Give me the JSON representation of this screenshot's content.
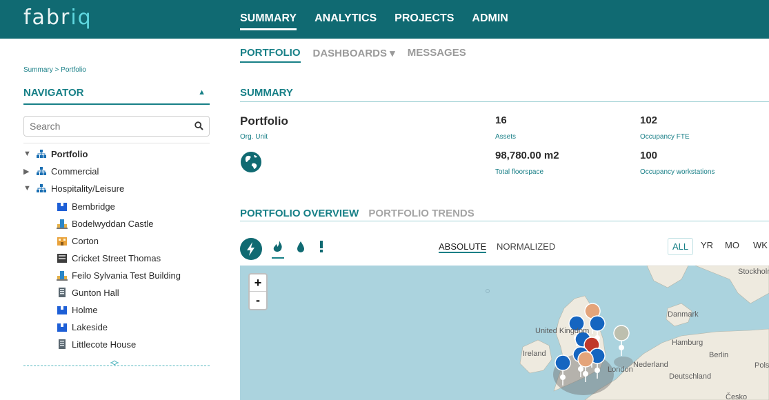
{
  "header": {
    "logo": "fabriq",
    "logo_main": "fabr",
    "logo_accent": "iq",
    "nav": [
      "SUMMARY",
      "ANALYTICS",
      "PROJECTS",
      "ADMIN"
    ],
    "active_nav": "SUMMARY"
  },
  "subnav": {
    "portfolio": "PORTFOLIO",
    "dashboards": "DASHBOARDS ▾",
    "messages": "MESSAGES"
  },
  "breadcrumb": "Summary > Portfolio",
  "navigator": {
    "title": "NAVIGATOR",
    "search_placeholder": "Search",
    "tree": [
      {
        "label": "Portfolio",
        "type": "org",
        "expanded": true
      },
      {
        "label": "Commercial",
        "type": "org",
        "expanded": false
      },
      {
        "label": "Hospitality/Leisure",
        "type": "org",
        "expanded": true
      },
      {
        "label": "Bembridge",
        "type": "building-blue"
      },
      {
        "label": "Bodelwyddan Castle",
        "type": "building-site"
      },
      {
        "label": "Corton",
        "type": "building-orange"
      },
      {
        "label": "Cricket Street Thomas",
        "type": "building-dark"
      },
      {
        "label": "Feilo Sylvania Test Building",
        "type": "building-site"
      },
      {
        "label": "Gunton Hall",
        "type": "building-tower"
      },
      {
        "label": "Holme",
        "type": "building-blue"
      },
      {
        "label": "Lakeside",
        "type": "building-blue"
      },
      {
        "label": "Littlecote House",
        "type": "building-tower"
      }
    ]
  },
  "summary": {
    "title": "SUMMARY",
    "org_name": "Portfolio",
    "org_type": "Org. Unit",
    "stats": [
      {
        "value": "16",
        "label": "Assets"
      },
      {
        "value": "102",
        "label": "Occupancy FTE"
      },
      {
        "value": "98,780.00 m2",
        "label": "Total floorspace"
      },
      {
        "value": "100",
        "label": "Occupancy workstations"
      }
    ]
  },
  "overview": {
    "tabs": [
      "PORTFOLIO OVERVIEW",
      "PORTFOLIO TRENDS"
    ],
    "modes": [
      "ABSOLUTE",
      "NORMALIZED"
    ],
    "periods": [
      "ALL",
      "YR",
      "MO",
      "WK"
    ],
    "active_period": "ALL",
    "zoom_in": "+",
    "zoom_out": "-",
    "map_labels": [
      "Stockholm",
      "Danmark",
      "United Kingdom",
      "Hamburg",
      "Berlin",
      "Ireland",
      "Nederland",
      "Deutschland",
      "Pols",
      "London",
      "Česko"
    ]
  },
  "colors": {
    "brand": "#106a72",
    "accent": "#167f86",
    "map_water": "#abd3de",
    "pin_blue": "#1565c0",
    "pin_orange": "#e4a47a",
    "pin_red": "#c0392b",
    "pin_grey": "#bdbfae"
  }
}
